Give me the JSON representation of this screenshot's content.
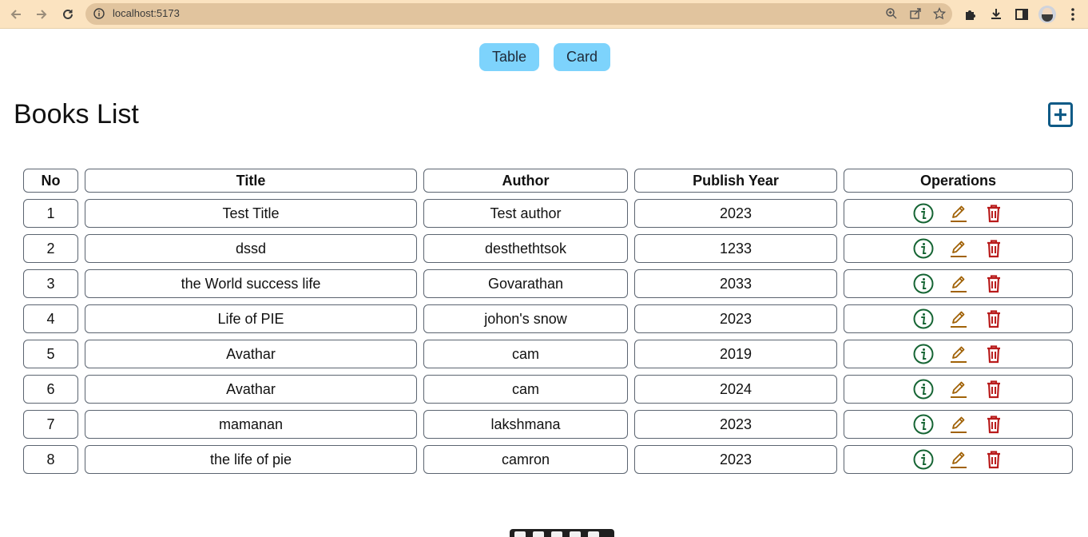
{
  "browser": {
    "url": "localhost:5173"
  },
  "view_toggle": {
    "table_label": "Table",
    "card_label": "Card"
  },
  "page": {
    "title": "Books List"
  },
  "table": {
    "headers": [
      "No",
      "Title",
      "Author",
      "Publish Year",
      "Operations"
    ],
    "rows": [
      {
        "no": "1",
        "title": "Test Title",
        "author": "Test author",
        "year": "2023"
      },
      {
        "no": "2",
        "title": "dssd",
        "author": "desthethtsok",
        "year": "1233"
      },
      {
        "no": "3",
        "title": "the World success life",
        "author": "Govarathan",
        "year": "2033"
      },
      {
        "no": "4",
        "title": "Life of PIE",
        "author": "johon's snow",
        "year": "2023"
      },
      {
        "no": "5",
        "title": "Avathar",
        "author": "cam",
        "year": "2019"
      },
      {
        "no": "6",
        "title": "Avathar",
        "author": "cam",
        "year": "2024"
      },
      {
        "no": "7",
        "title": "mamanan",
        "author": "lakshmana",
        "year": "2023"
      },
      {
        "no": "8",
        "title": "the life of pie",
        "author": "camron",
        "year": "2023"
      }
    ],
    "operations": [
      "info-circle-icon",
      "edit-pencil-icon",
      "delete-trash-icon"
    ]
  },
  "colors": {
    "chrome_bg": "#fbe3c0",
    "toggle_bg": "#7dd3fc",
    "add_icon": "#0e5a86",
    "info_icon": "#166534",
    "edit_icon": "#a16207",
    "delete_icon": "#b91c1c"
  }
}
